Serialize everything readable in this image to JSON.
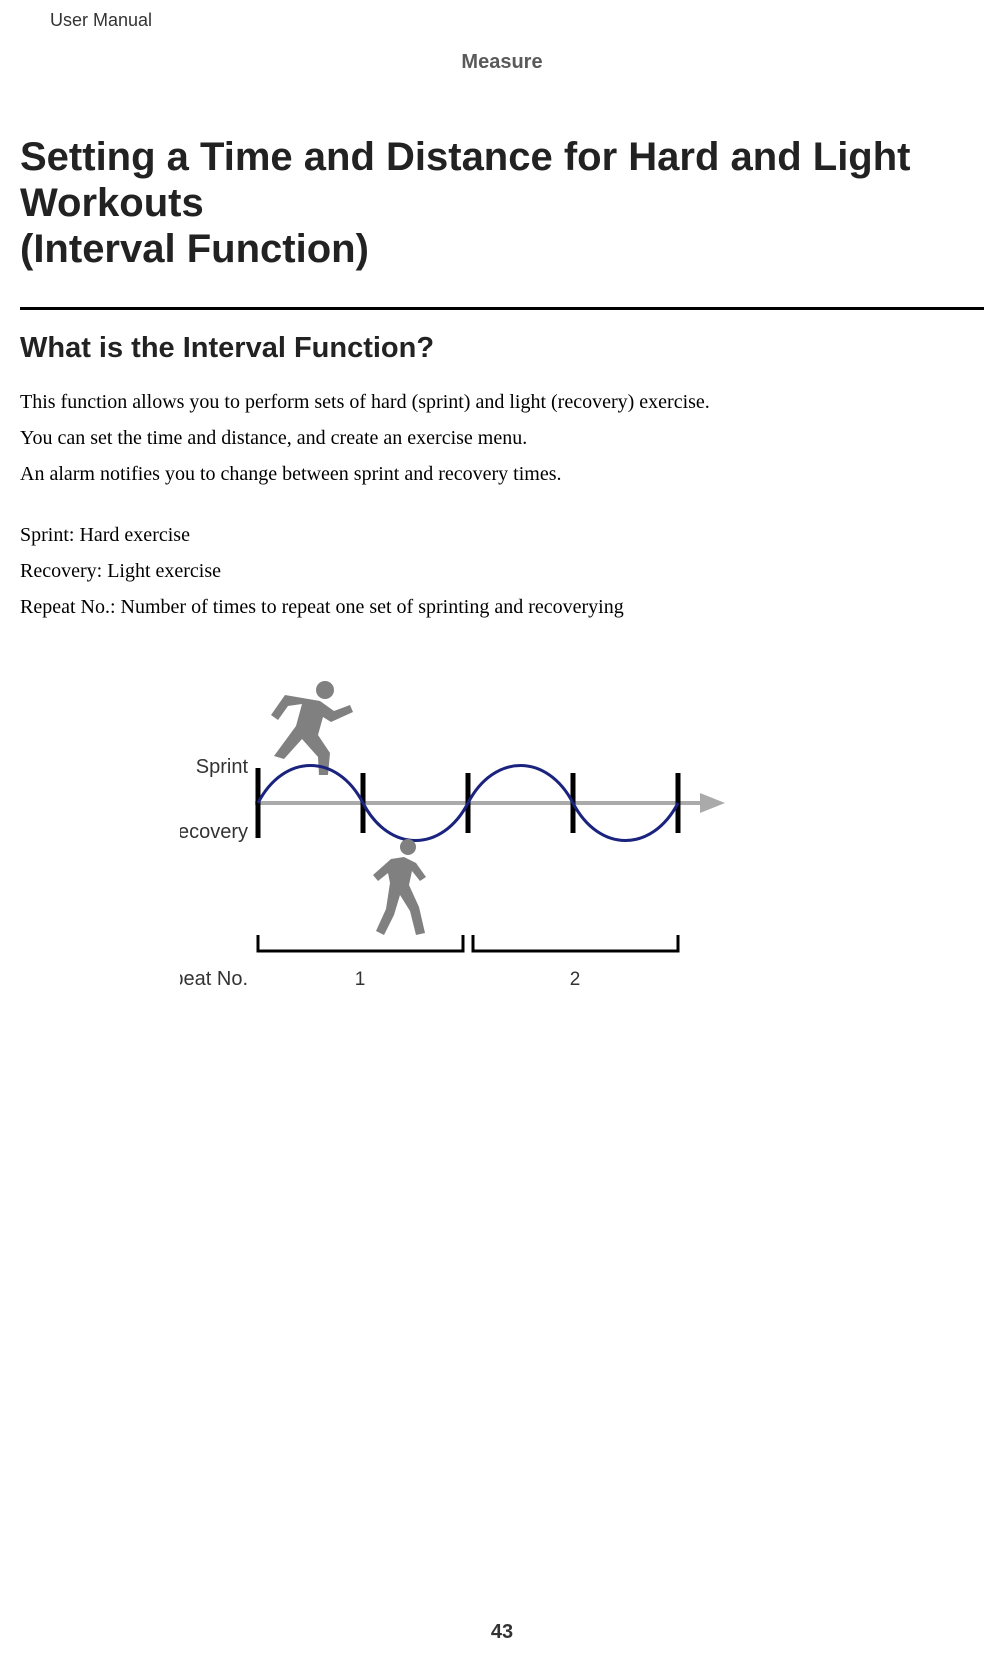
{
  "header": {
    "doc_type": "User Manual",
    "section": "Measure"
  },
  "title": {
    "line1": "Setting a Time and Distance for Hard and Light Workouts",
    "line2": "(Interval Function)"
  },
  "subheading": "What is the Interval Function?",
  "paragraphs": {
    "p1": "This function allows you to perform sets of hard (sprint) and light (recovery) exercise.",
    "p2": "You can set the time and distance, and create an exercise menu.",
    "p3": "An alarm notifies you to change between sprint and recovery times.",
    "p4": "Sprint: Hard exercise",
    "p5": "Recovery: Light exercise",
    "p6": "Repeat No.: Number of times to repeat one set of sprinting and recoverying"
  },
  "diagram": {
    "sprint_label": "Sprint",
    "recovery_label": "Recovery",
    "repeat_label": "Repeat No.",
    "repeat_num_1": "1",
    "repeat_num_2": "2"
  },
  "page_number": "43"
}
